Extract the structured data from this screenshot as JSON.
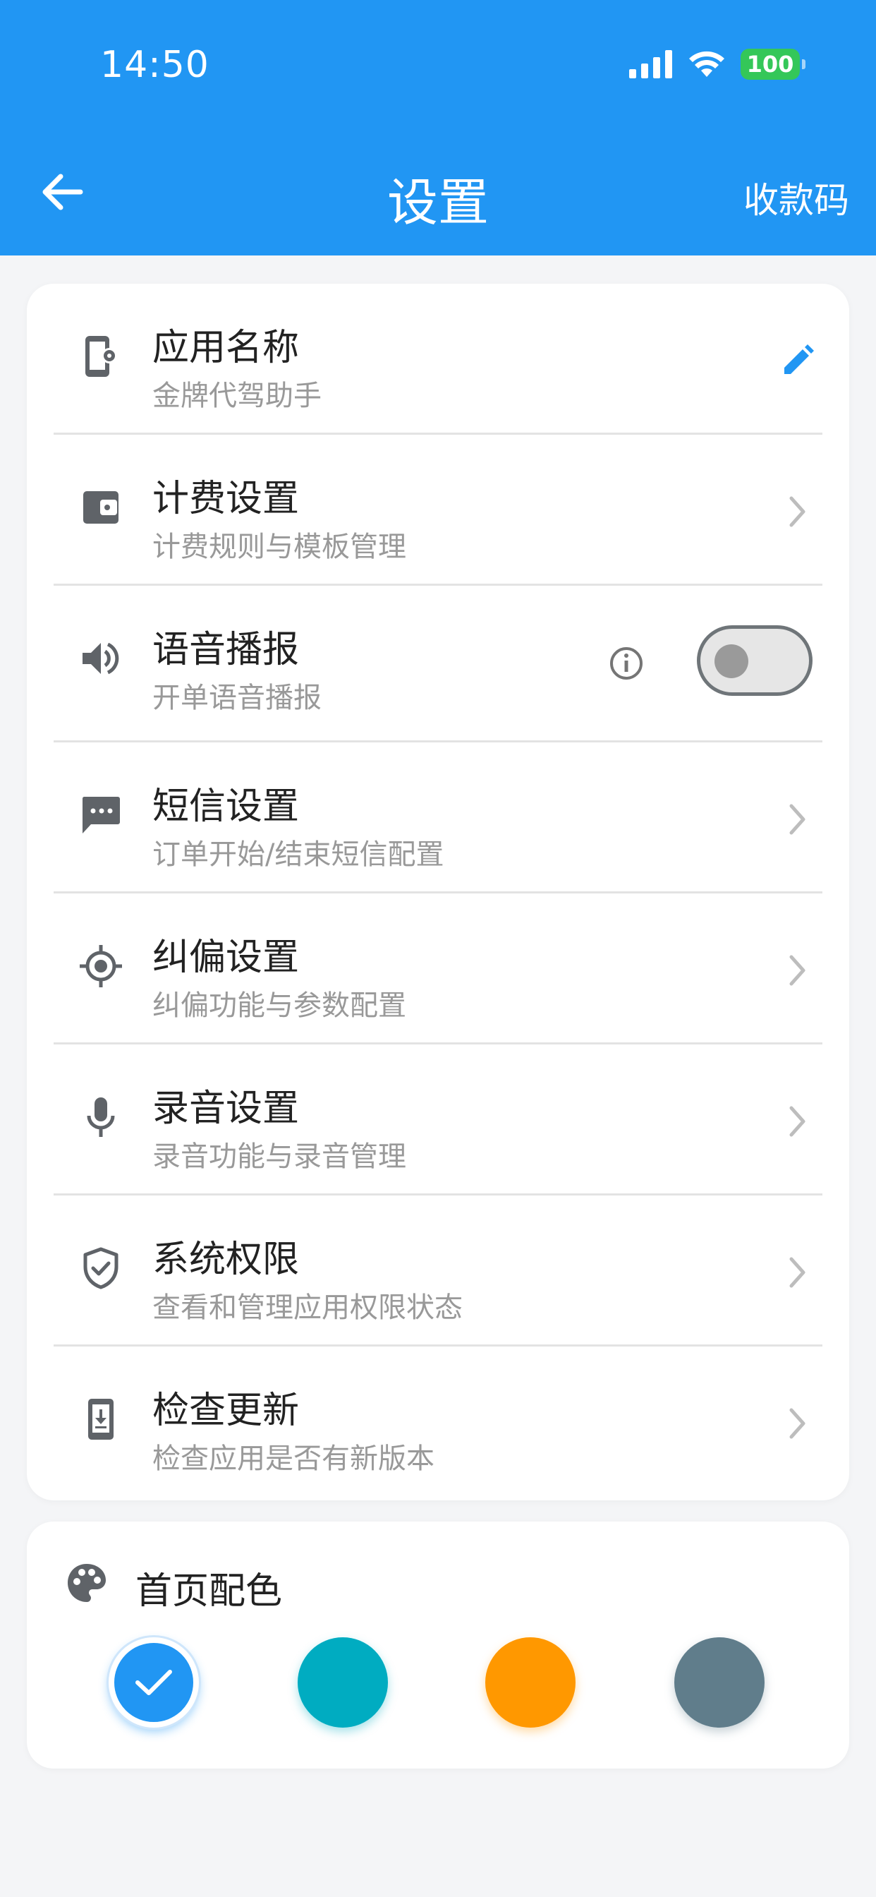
{
  "status": {
    "time": "14:50",
    "battery": "100"
  },
  "header": {
    "title": "设置",
    "right_action": "收款码"
  },
  "settings": [
    {
      "title": "应用名称",
      "subtitle": "金牌代驾助手",
      "icon": "app-settings-icon",
      "right": "edit-icon"
    },
    {
      "title": "计费设置",
      "subtitle": "计费规则与模板管理",
      "icon": "wallet-icon",
      "right": "chevron-right-icon"
    },
    {
      "title": "语音播报",
      "subtitle": "开单语音播报",
      "icon": "speaker-icon",
      "right": "toggle",
      "toggle_on": false
    },
    {
      "title": "短信设置",
      "subtitle": "订单开始/结束短信配置",
      "icon": "sms-icon",
      "right": "chevron-right-icon"
    },
    {
      "title": "纠偏设置",
      "subtitle": "纠偏功能与参数配置",
      "icon": "gps-target-icon",
      "right": "chevron-right-icon"
    },
    {
      "title": "录音设置",
      "subtitle": "录音功能与录音管理",
      "icon": "microphone-icon",
      "right": "chevron-right-icon"
    },
    {
      "title": "系统权限",
      "subtitle": "查看和管理应用权限状态",
      "icon": "shield-check-icon",
      "right": "chevron-right-icon"
    },
    {
      "title": "检查更新",
      "subtitle": "检查应用是否有新版本",
      "icon": "phone-download-icon",
      "right": "chevron-right-icon"
    }
  ],
  "theme": {
    "title": "首页配色",
    "colors": [
      "#2196f3",
      "#00acc1",
      "#ff9800",
      "#607d8b"
    ],
    "selected_index": 0
  }
}
